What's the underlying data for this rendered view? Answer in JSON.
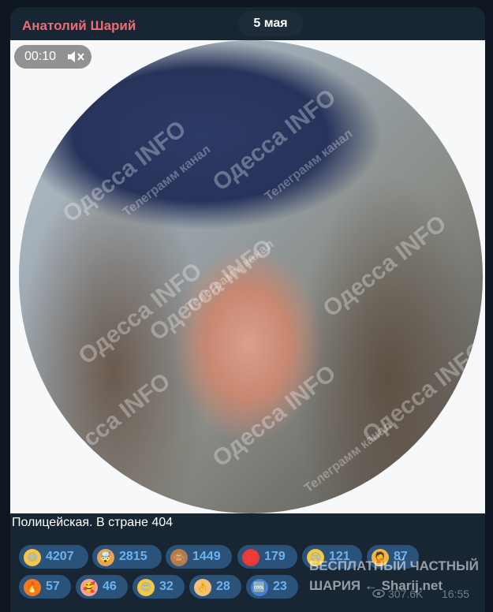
{
  "message": {
    "author": "Анатолий Шарий",
    "date_pill": "5 мая",
    "video": {
      "duration": "00:10",
      "muted": true,
      "watermark_main": "Одесса INFO",
      "watermark_sub": "Телеграмм канал"
    },
    "caption": "Полицейская. В стране 404",
    "reactions": [
      {
        "emoji_name": "grinning-face-icon",
        "glyph": "😄",
        "color": "#f6c644",
        "count": "4207"
      },
      {
        "emoji_name": "exploding-head-icon",
        "glyph": "🤯",
        "color": "#e6a35a",
        "count": "2815"
      },
      {
        "emoji_name": "see-no-evil-monkey-icon",
        "glyph": "🙈",
        "color": "#b47a4a",
        "count": "1449"
      },
      {
        "emoji_name": "hundred-points-icon",
        "glyph": "💯",
        "color": "#e33b3b",
        "count": "179"
      },
      {
        "emoji_name": "crying-face-icon",
        "glyph": "😢",
        "color": "#f6c644",
        "count": "121"
      },
      {
        "emoji_name": "facepalm-icon",
        "glyph": "🤦",
        "color": "#f0b640",
        "count": "87"
      },
      {
        "emoji_name": "fire-icon",
        "glyph": "🔥",
        "color": "#f07b1e",
        "count": "57"
      },
      {
        "emoji_name": "smiling-face-with-hearts-icon",
        "glyph": "🥰",
        "color": "#f6a0a0",
        "count": "46"
      },
      {
        "emoji_name": "heart-eyes-icon",
        "glyph": "😍",
        "color": "#f6c644",
        "count": "32"
      },
      {
        "emoji_name": "ok-hand-icon",
        "glyph": "👌",
        "color": "#f2c07a",
        "count": "28"
      },
      {
        "emoji_name": "cool-button-icon",
        "glyph": "🆒",
        "color": "#4a7fd6",
        "count": "23"
      }
    ],
    "views": "307.6K",
    "time": "16:55",
    "overlay_watermark": {
      "line1": "БЕСПЛАТНЫЙ ЧАСТНЫЙ",
      "line2": "ШАРИЯ ← Sharij.net"
    }
  }
}
